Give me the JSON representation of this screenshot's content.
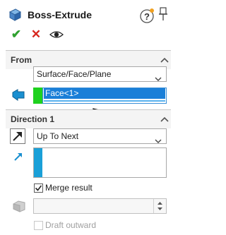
{
  "header": {
    "title": "Boss-Extrude",
    "help_icon": "help-question-icon",
    "pin_icon": "pushpin-icon",
    "feature_icon": "boss-extrude-icon"
  },
  "actions": {
    "ok_icon": "checkmark-icon",
    "cancel_icon": "cancel-x-icon",
    "preview_icon": "eye-icon",
    "ok_symbol": "✔",
    "cancel_symbol": "✕"
  },
  "from_section": {
    "title": "From",
    "start_condition": "Surface/Face/Plane",
    "selected_entity": "Face<1>"
  },
  "direction1_section": {
    "title": "Direction 1",
    "end_condition": "Up To Next",
    "merge_result_label": "Merge result",
    "merge_result_checked": true,
    "draft_outward_label": "Draft outward",
    "draft_outward_checked": false
  },
  "colors": {
    "ok": "#2fa12f",
    "cancel": "#d7261e",
    "selection_highlight": "#1a7fd8",
    "entity_marker": "#1fd11f",
    "direction_marker": "#1aa0d8"
  }
}
